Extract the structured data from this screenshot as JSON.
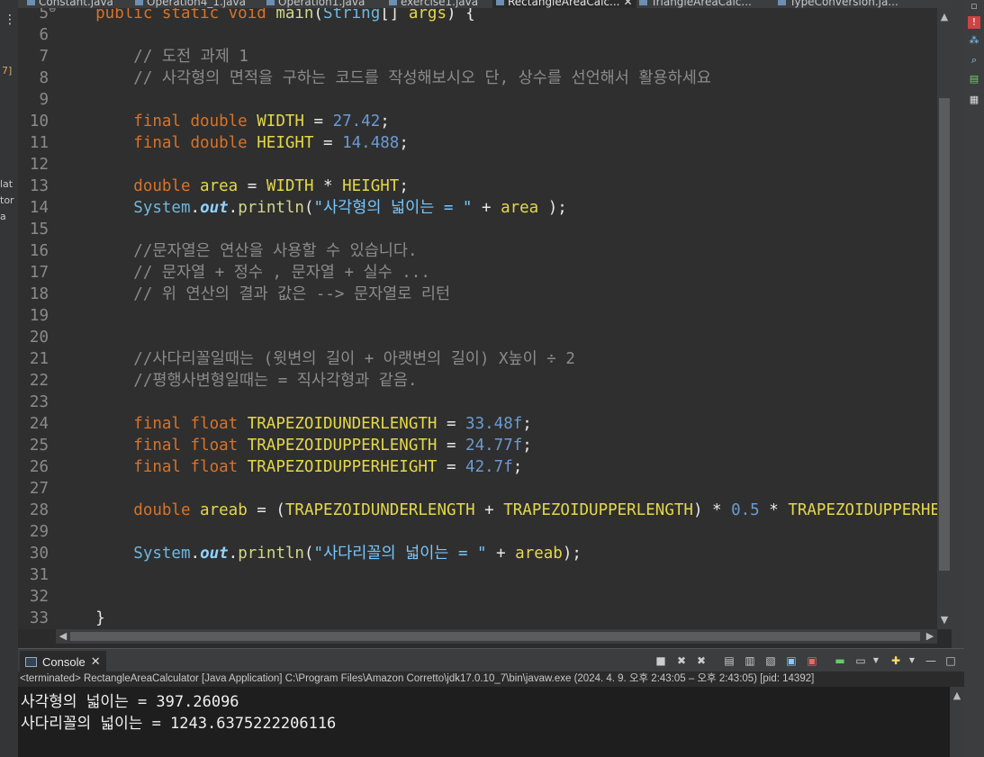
{
  "window_left_fragments": [
    "7]",
    "lat",
    "tor",
    "a"
  ],
  "tabs": [
    {
      "label": "Constant.java"
    },
    {
      "label": "Operation4_1.java"
    },
    {
      "label": "Operation1.java"
    },
    {
      "label": "exercise1.java"
    },
    {
      "label": "RectangleAreaCalc...",
      "active": true
    },
    {
      "label": "TriangleAreaCalc..."
    },
    {
      "label": "TypeConversion.ja..."
    }
  ],
  "editor": {
    "lines": [
      {
        "num": "5",
        "marker": "⊖",
        "tokens": [
          {
            "c": "kw",
            "t": "    public static void "
          },
          {
            "c": "meth",
            "t": "main"
          },
          {
            "c": "pl",
            "t": "("
          },
          {
            "c": "sys",
            "t": "String"
          },
          {
            "c": "pl",
            "t": "[] "
          },
          {
            "c": "var",
            "t": "args"
          },
          {
            "c": "pl",
            "t": ") {"
          }
        ]
      },
      {
        "num": "6",
        "tokens": []
      },
      {
        "num": "7",
        "tokens": [
          {
            "c": "cm",
            "t": "        // 도전 과제 1"
          }
        ]
      },
      {
        "num": "8",
        "tokens": [
          {
            "c": "cm",
            "t": "        // 사각형의 면적을 구하는 코드를 작성해보시오 단, 상수를 선언해서 활용하세요"
          }
        ]
      },
      {
        "num": "9",
        "tokens": []
      },
      {
        "num": "10",
        "tokens": [
          {
            "c": "kw",
            "t": "        final double "
          },
          {
            "c": "const",
            "t": "WIDTH"
          },
          {
            "c": "pl",
            "t": " = "
          },
          {
            "c": "num",
            "t": "27.42"
          },
          {
            "c": "pl",
            "t": ";"
          }
        ]
      },
      {
        "num": "11",
        "tokens": [
          {
            "c": "kw",
            "t": "        final double "
          },
          {
            "c": "const",
            "t": "HEIGHT"
          },
          {
            "c": "pl",
            "t": " = "
          },
          {
            "c": "num",
            "t": "14.488"
          },
          {
            "c": "pl",
            "t": ";"
          }
        ]
      },
      {
        "num": "12",
        "tokens": []
      },
      {
        "num": "13",
        "tokens": [
          {
            "c": "kw",
            "t": "        double "
          },
          {
            "c": "var",
            "t": "area"
          },
          {
            "c": "pl",
            "t": " = "
          },
          {
            "c": "const",
            "t": "WIDTH"
          },
          {
            "c": "pl",
            "t": " * "
          },
          {
            "c": "const",
            "t": "HEIGHT"
          },
          {
            "c": "pl",
            "t": ";"
          }
        ]
      },
      {
        "num": "14",
        "tokens": [
          {
            "c": "sys",
            "t": "        System"
          },
          {
            "c": "pl",
            "t": "."
          },
          {
            "c": "fld",
            "t": "out"
          },
          {
            "c": "pl",
            "t": "."
          },
          {
            "c": "meth",
            "t": "println"
          },
          {
            "c": "pl",
            "t": "("
          },
          {
            "c": "str",
            "t": "\"사각형의 넓이는 = \""
          },
          {
            "c": "pl",
            "t": " + "
          },
          {
            "c": "var",
            "t": "area"
          },
          {
            "c": "pl",
            "t": " );"
          }
        ]
      },
      {
        "num": "15",
        "tokens": []
      },
      {
        "num": "16",
        "tokens": [
          {
            "c": "cm",
            "t": "        //문자열은 연산을 사용할 수 있습니다."
          }
        ]
      },
      {
        "num": "17",
        "tokens": [
          {
            "c": "cm",
            "t": "        // 문자열 + 정수 , 문자열 + 실수 ..."
          }
        ]
      },
      {
        "num": "18",
        "tokens": [
          {
            "c": "cm",
            "t": "        // 위 연산의 결과 값은 --> 문자열로 리턴"
          }
        ]
      },
      {
        "num": "19",
        "tokens": []
      },
      {
        "num": "20",
        "tokens": []
      },
      {
        "num": "21",
        "tokens": [
          {
            "c": "cm",
            "t": "        //사다리꼴일때는 (윗변의 길이 + 아랫변의 길이) X높이 ÷ 2"
          }
        ]
      },
      {
        "num": "22",
        "tokens": [
          {
            "c": "cm",
            "t": "        //평행사변형일때는 = 직사각형과 같음."
          }
        ]
      },
      {
        "num": "23",
        "tokens": []
      },
      {
        "num": "24",
        "tokens": [
          {
            "c": "kw",
            "t": "        final float "
          },
          {
            "c": "const",
            "t": "TRAPEZOIDUNDERLENGTH"
          },
          {
            "c": "pl",
            "t": " = "
          },
          {
            "c": "num",
            "t": "33.48f"
          },
          {
            "c": "pl",
            "t": ";"
          }
        ]
      },
      {
        "num": "25",
        "tokens": [
          {
            "c": "kw",
            "t": "        final float "
          },
          {
            "c": "const",
            "t": "TRAPEZOIDUPPERLENGTH"
          },
          {
            "c": "pl",
            "t": " = "
          },
          {
            "c": "num",
            "t": "24.77f"
          },
          {
            "c": "pl",
            "t": ";"
          }
        ]
      },
      {
        "num": "26",
        "tokens": [
          {
            "c": "kw",
            "t": "        final float "
          },
          {
            "c": "const",
            "t": "TRAPEZOIDUPPERHEIGHT"
          },
          {
            "c": "pl",
            "t": " = "
          },
          {
            "c": "num",
            "t": "42.7f"
          },
          {
            "c": "pl",
            "t": ";"
          }
        ]
      },
      {
        "num": "27",
        "tokens": []
      },
      {
        "num": "28",
        "tokens": [
          {
            "c": "kw",
            "t": "        double "
          },
          {
            "c": "var",
            "t": "areab"
          },
          {
            "c": "pl",
            "t": " = ("
          },
          {
            "c": "const",
            "t": "TRAPEZOIDUNDERLENGTH"
          },
          {
            "c": "pl",
            "t": " + "
          },
          {
            "c": "const",
            "t": "TRAPEZOIDUPPERLENGTH"
          },
          {
            "c": "pl",
            "t": ") * "
          },
          {
            "c": "num",
            "t": "0.5"
          },
          {
            "c": "pl",
            "t": " * "
          },
          {
            "c": "const",
            "t": "TRAPEZOIDUPPERHEIGHT"
          },
          {
            "c": "pl",
            "t": ";"
          }
        ]
      },
      {
        "num": "29",
        "tokens": []
      },
      {
        "num": "30",
        "tokens": [
          {
            "c": "sys",
            "t": "        System"
          },
          {
            "c": "pl",
            "t": "."
          },
          {
            "c": "fld",
            "t": "out"
          },
          {
            "c": "pl",
            "t": "."
          },
          {
            "c": "meth",
            "t": "println"
          },
          {
            "c": "pl",
            "t": "("
          },
          {
            "c": "str",
            "t": "\"사다리꼴의 넓이는 = \""
          },
          {
            "c": "pl",
            "t": " + "
          },
          {
            "c": "var",
            "t": "areab"
          },
          {
            "c": "pl",
            "t": ");"
          }
        ]
      },
      {
        "num": "31",
        "tokens": []
      },
      {
        "num": "32",
        "tokens": []
      },
      {
        "num": "33",
        "tokens": [
          {
            "c": "pl",
            "t": "    }"
          }
        ]
      }
    ]
  },
  "console": {
    "tab_label": "Console",
    "status": "<terminated> RectangleAreaCalculator [Java Application] C:\\Program Files\\Amazon Corretto\\jdk17.0.10_7\\bin\\javaw.exe  (2024. 4. 9. 오후 2:43:05 – 오후 2:43:05) [pid: 14392]",
    "output": [
      "사각형의 넓이는 = 397.26096",
      "사다리꼴의 넓이는 = 1243.6375222206116"
    ]
  }
}
